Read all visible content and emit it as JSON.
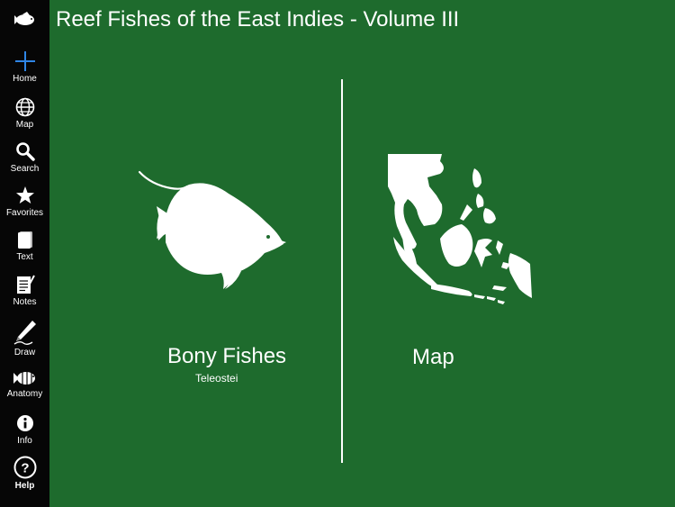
{
  "app": {
    "title": "Reef Fishes of the East Indies - Volume III"
  },
  "sidebar": {
    "items": [
      {
        "id": "home",
        "label": "Home",
        "icon": "plus-icon"
      },
      {
        "id": "map",
        "label": "Map",
        "icon": "globe-icon"
      },
      {
        "id": "search",
        "label": "Search",
        "icon": "magnifier-icon"
      },
      {
        "id": "favorites",
        "label": "Favorites",
        "icon": "star-icon"
      },
      {
        "id": "text",
        "label": "Text",
        "icon": "page-icon"
      },
      {
        "id": "notes",
        "label": "Notes",
        "icon": "notepad-icon"
      },
      {
        "id": "draw",
        "label": "Draw",
        "icon": "pencil-icon"
      },
      {
        "id": "anatomy",
        "label": "Anatomy",
        "icon": "fish-anatomy-icon"
      },
      {
        "id": "info",
        "label": "Info",
        "icon": "info-icon"
      },
      {
        "id": "help",
        "label": "Help",
        "icon": "question-icon"
      }
    ]
  },
  "main": {
    "bony_fishes": {
      "title": "Bony Fishes",
      "subtitle": "Teleostei",
      "icon": "butterflyfish-silhouette"
    },
    "map": {
      "title": "Map",
      "icon": "east-indies-map-silhouette"
    }
  },
  "colors": {
    "background": "#1e6b2d",
    "sidebar": "#060606",
    "accent": "#2f86e6",
    "foreground": "#ffffff"
  }
}
